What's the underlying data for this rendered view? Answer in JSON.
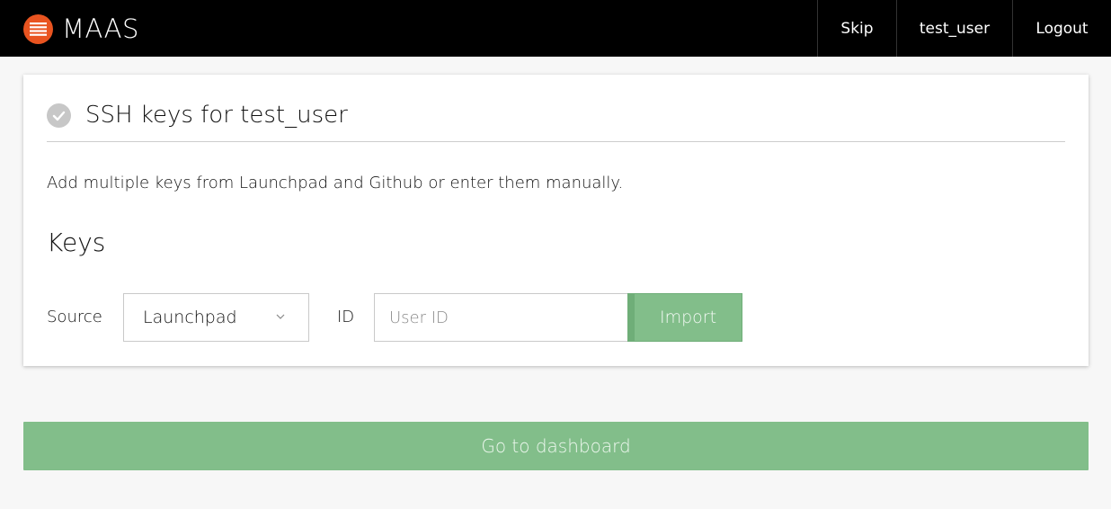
{
  "app": {
    "title": "MAAS",
    "logo_icon": "menu-lines-icon",
    "accent_color": "#e95420"
  },
  "nav": {
    "skip_label": "Skip",
    "user_label": "test_user",
    "logout_label": "Logout"
  },
  "card": {
    "status_icon": "check-circle-icon",
    "title": "SSH keys for test_user",
    "intro": "Add multiple keys from Launchpad and Github or enter them manually.",
    "keys_heading": "Keys"
  },
  "form": {
    "source_label": "Source",
    "source_value": "Launchpad",
    "id_label": "ID",
    "id_placeholder": "User ID",
    "id_value": "",
    "import_label": "Import",
    "button_color": "#82be8a"
  },
  "footer": {
    "dashboard_label": "Go to dashboard"
  }
}
